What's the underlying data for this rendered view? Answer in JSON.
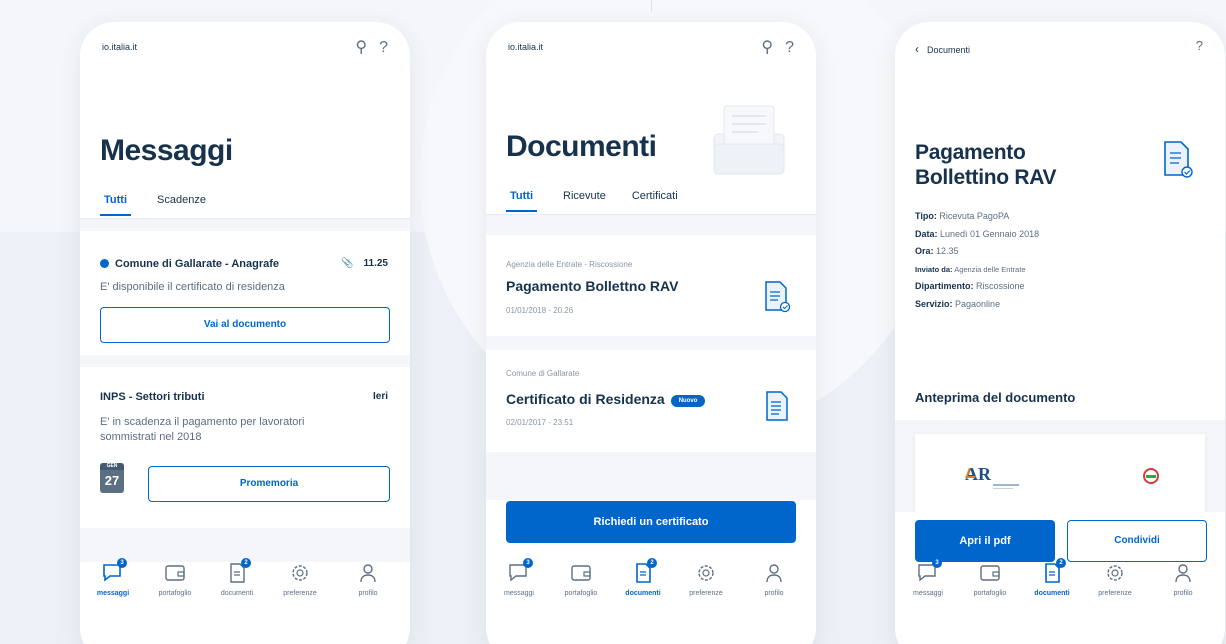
{
  "phone1": {
    "site": "io.italia.it",
    "title": "Messaggi",
    "tabs": [
      "Tutti",
      "Scadenze"
    ],
    "message1": {
      "sender": "Comune di Gallarate - Anagrafe",
      "time": "11.25",
      "text": "E' disponibile il certificato di residenza",
      "action": "Vai al documento"
    },
    "message2": {
      "sender": "INPS - Settori tributi",
      "time": "Ieri",
      "text": "E' in scadenza il pagamento per lavoratori sommistrati nel 2018",
      "calendar_month": "GEN",
      "calendar_day": "27",
      "action": "Promemoria"
    },
    "tabbar": [
      {
        "label": "messaggi",
        "badge": "3"
      },
      {
        "label": "portafoglio"
      },
      {
        "label": "documenti",
        "badge": "2"
      },
      {
        "label": "preferenze"
      },
      {
        "label": "profilo"
      }
    ]
  },
  "phone2": {
    "site": "io.italia.it",
    "title": "Documenti",
    "tabs": [
      "Tutti",
      "Ricevute",
      "Certificati"
    ],
    "doc1": {
      "meta": "Agenzia delle Entrate - Riscossione",
      "title": "Pagamento Bollettno RAV",
      "date": "01/01/2018 - 20.26"
    },
    "doc2": {
      "meta": "Comune di Gallarate",
      "title": "Certificato di Residenza",
      "badge": "Nuovo",
      "date": "02/01/2017 - 23.51"
    },
    "action": "Richiedi un certificato",
    "tabbar": [
      {
        "label": "messaggi",
        "badge": "3"
      },
      {
        "label": "portafoglio"
      },
      {
        "label": "documenti",
        "badge": "2"
      },
      {
        "label": "preferenze"
      },
      {
        "label": "profilo"
      }
    ]
  },
  "phone3": {
    "back_label": "Documenti",
    "help": "?",
    "title": "Pagamento Bollettino RAV",
    "details": [
      {
        "label": "Tipo:",
        "value": "Ricevuta PagoPA"
      },
      {
        "label": "Data:",
        "value": "Lunedì 01 Gennaio 2018"
      },
      {
        "label": "Ora:",
        "value": "12.35"
      },
      {
        "label": "Inviato da:",
        "value": "Agenzia delle Entrate"
      },
      {
        "label": "Dipartimento:",
        "value": "Riscossione"
      },
      {
        "label": "Servizio:",
        "value": "Pagaonline"
      }
    ],
    "preview_title": "Anteprima del documento",
    "preview_logo": "AR",
    "primary_action": "Apri il pdf",
    "secondary_action": "Condividi",
    "tabbar": [
      {
        "label": "messaggi",
        "badge": "3"
      },
      {
        "label": "portafoglio"
      },
      {
        "label": "documenti",
        "badge": "2"
      },
      {
        "label": "preferenze"
      },
      {
        "label": "profilo"
      }
    ]
  },
  "colors": {
    "primary": "#0066cc",
    "text": "#17324d",
    "muted": "#5c6f82",
    "background": "#f4f6fa"
  }
}
